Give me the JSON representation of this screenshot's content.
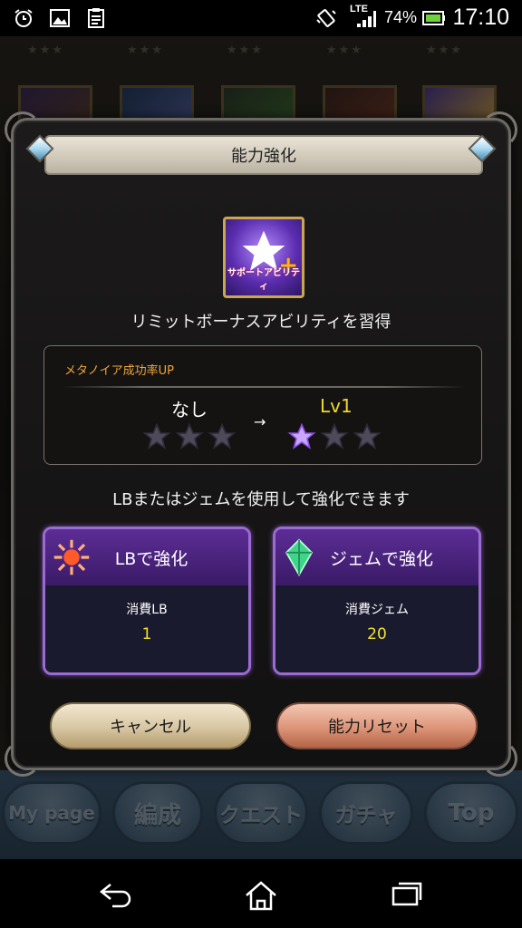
{
  "status_bar": {
    "icons": [
      "alarm-icon",
      "image-icon",
      "clipboard-icon",
      "vibrate-icon",
      "signal-icon",
      "battery-icon"
    ],
    "network": "LTE",
    "battery": "74%",
    "time": "17:10"
  },
  "dialog": {
    "title": "能力強化",
    "skill_caption": "サポートアビリティ",
    "learn_text": "リミットボーナスアビリティを習得",
    "ability_name": "メタノイア成功率UP",
    "level_before": "なし",
    "level_after": "Lv1",
    "arrow": "→",
    "stars_before_filled": 0,
    "stars_after_filled": 1,
    "stars_total": 3,
    "hint": "LBまたはジェムを使用して強化できます",
    "lb_card": {
      "title": "LBで強化",
      "cost_label": "消費LB",
      "cost_value": "1"
    },
    "gem_card": {
      "title": "ジェムで強化",
      "cost_label": "消費ジェム",
      "cost_value": "20"
    },
    "cancel_label": "キャンセル",
    "reset_label": "能力リセット"
  },
  "game_nav": [
    "My page",
    "編成",
    "クエスト",
    "ガチャ",
    "Top"
  ],
  "colors": {
    "accent_purple": "#9a6bd0",
    "level_yellow": "#f0d92d",
    "ability_orange": "#f0a73a"
  }
}
